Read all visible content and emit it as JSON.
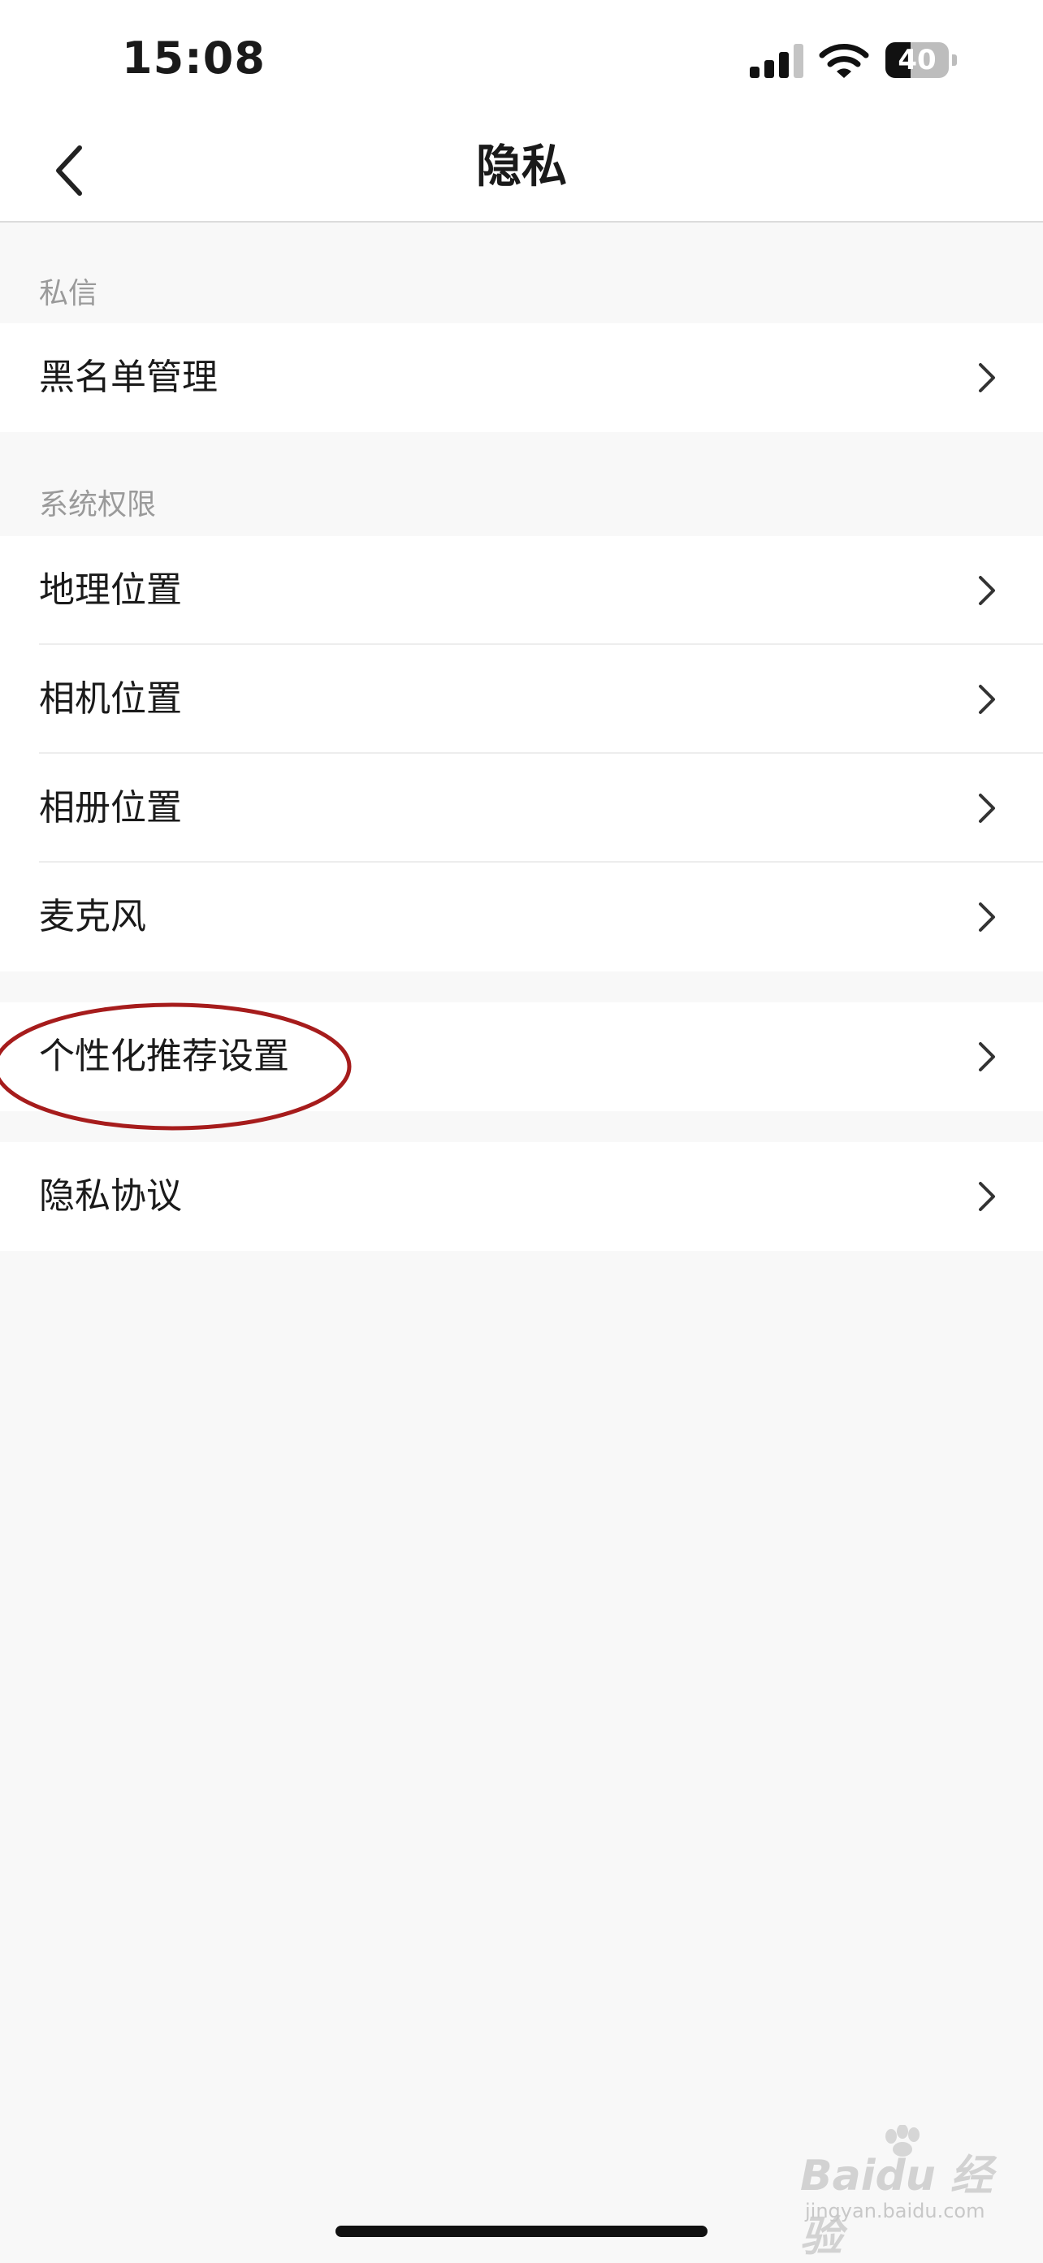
{
  "status_bar": {
    "time": "15:08",
    "battery": "40",
    "battery_level": 0.4
  },
  "nav": {
    "title": "隐私",
    "back_icon": "chevron-left-icon"
  },
  "sections": [
    {
      "header": "私信",
      "items": [
        {
          "label": "黑名单管理"
        }
      ]
    },
    {
      "header": "系统权限",
      "items": [
        {
          "label": "地理位置"
        },
        {
          "label": "相机位置"
        },
        {
          "label": "相册位置"
        },
        {
          "label": "麦克风"
        }
      ]
    },
    {
      "header": "",
      "items": [
        {
          "label": "个性化推荐设置"
        }
      ]
    },
    {
      "header": "",
      "items": [
        {
          "label": "隐私协议"
        }
      ]
    }
  ],
  "row_icon": "chevron-right-icon",
  "annotation_color": "#a61c1c",
  "watermark": {
    "brand": "Baidu 经验",
    "sub": "jingyan.baidu.com"
  }
}
